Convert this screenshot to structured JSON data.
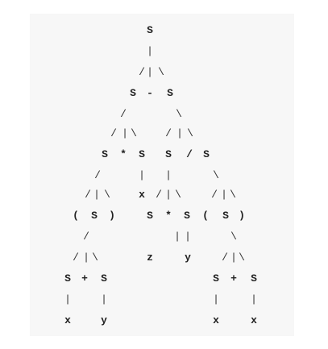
{
  "title": "",
  "tree": {
    "rows": [
      [
        {
          "c": "S"
        }
      ],
      [
        {
          "c": "|"
        }
      ],
      [
        {
          "c": "/"
        },
        {
          "c": "|"
        },
        {
          "c": "\\"
        }
      ],
      [
        {
          "c": "S"
        },
        {
          "c": "-"
        },
        {
          "c": "S"
        }
      ],
      [
        {
          "c": "/"
        },
        {
          "c": "\\"
        }
      ],
      [
        {
          "c": "/"
        },
        {
          "c": "|"
        },
        {
          "c": "\\"
        },
        {
          "c": "/"
        },
        {
          "c": "|"
        },
        {
          "c": "\\"
        }
      ],
      [
        {
          "c": "S"
        },
        {
          "c": "*"
        },
        {
          "c": "S"
        },
        {
          "c": "S"
        },
        {
          "c": "/"
        },
        {
          "c": "S"
        }
      ],
      [
        {
          "c": "/"
        },
        {
          "c": "|"
        },
        {
          "c": "|"
        },
        {
          "c": "\\"
        }
      ],
      [
        {
          "c": "/"
        },
        {
          "c": "|"
        },
        {
          "c": "\\"
        },
        {
          "c": "x"
        },
        {
          "c": "/"
        },
        {
          "c": "|"
        },
        {
          "c": "\\"
        },
        {
          "c": "/"
        },
        {
          "c": "|"
        },
        {
          "c": "\\"
        }
      ],
      [
        {
          "c": "("
        },
        {
          "c": "S"
        },
        {
          "c": ")"
        },
        {
          "c": "S"
        },
        {
          "c": "*"
        },
        {
          "c": "S"
        },
        {
          "c": "("
        },
        {
          "c": "S"
        },
        {
          "c": ")"
        }
      ],
      [
        {
          "c": "/"
        },
        {
          "c": "|"
        },
        {
          "c": "|"
        },
        {
          "c": "\\"
        }
      ],
      [
        {
          "c": "/"
        },
        {
          "c": "|"
        },
        {
          "c": "\\"
        },
        {
          "c": "z"
        },
        {
          "c": "y"
        },
        {
          "c": "/"
        },
        {
          "c": "|"
        },
        {
          "c": "\\"
        }
      ],
      [
        {
          "c": "S"
        },
        {
          "c": "+"
        },
        {
          "c": "S"
        },
        {
          "c": "S"
        },
        {
          "c": "+"
        },
        {
          "c": "S"
        }
      ],
      [
        {
          "c": "|"
        },
        {
          "c": "|"
        },
        {
          "c": "|"
        },
        {
          "c": "|"
        }
      ],
      [
        {
          "c": "x"
        },
        {
          "c": "y"
        },
        {
          "c": "x"
        },
        {
          "c": "x"
        }
      ]
    ]
  }
}
